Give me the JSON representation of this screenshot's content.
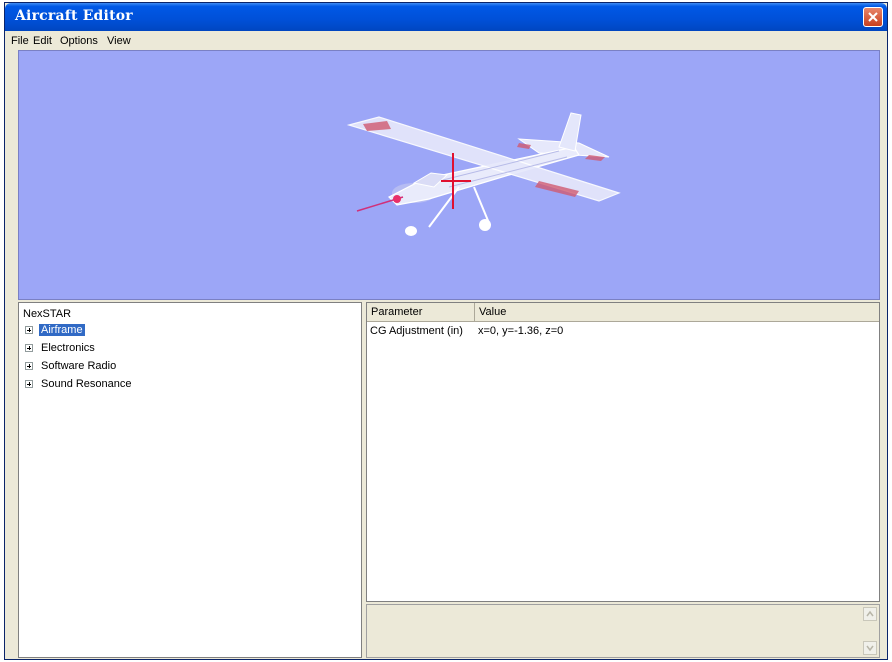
{
  "window": {
    "title": "Aircraft Editor"
  },
  "menu": [
    "File",
    "Edit",
    "Options",
    "View"
  ],
  "tree": {
    "root": "NexSTAR",
    "items": [
      {
        "label": "Airframe",
        "selected": true
      },
      {
        "label": "Electronics",
        "selected": false
      },
      {
        "label": "Software Radio",
        "selected": false
      },
      {
        "label": "Sound Resonance",
        "selected": false
      }
    ]
  },
  "grid": {
    "headers": {
      "parameter": "Parameter",
      "value": "Value"
    },
    "rows": [
      {
        "parameter": "CG Adjustment (in)",
        "value": "x=0, y=-1.36, z=0"
      }
    ]
  },
  "colors": {
    "viewport_bg": "#9ca6f7",
    "selection": "#316ac5",
    "titlebar": "#0054e3"
  }
}
